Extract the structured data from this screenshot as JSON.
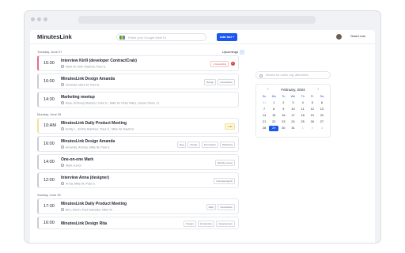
{
  "app": {
    "logo": "MinutesLink",
    "search_placeholder": "Paste your Google Meet ID",
    "add_button": "Add bot +",
    "user_name": "David Luis"
  },
  "header": {
    "upcoming_label": "Upcomings"
  },
  "sections": [
    {
      "date": "Tuesday, June 27",
      "events": [
        {
          "time": "16:30",
          "title": "Interview Kirill (developer ContractCrab)",
          "people": "Mark M, Kirill Vlashna, Paul S.",
          "tags": [
            {
              "label": "• Connecting",
              "style": "red"
            }
          ],
          "badge": "1",
          "accent": "#e86b8a"
        },
        {
          "time": "16:00",
          "title": "MinutesLink Design Amanda",
          "people": "Amanda, Mark M, Paul S.",
          "tags": [
            {
              "label": "Design",
              "style": ""
            },
            {
              "label": "Introduction",
              "style": ""
            }
          ],
          "accent": "#c9ccd3"
        },
        {
          "time": "14:30",
          "title": "Marketing meetup",
          "people": "Baru, Anthony Maninez, Paul S., Mike W, Peter Miles, Susan Owns +1",
          "tags": [],
          "accent": "#c9ccd3"
        }
      ]
    },
    {
      "date": "Monday, June 26",
      "events": [
        {
          "time": "10:AM",
          "title": "MinutesLink Daily Product Meeting",
          "people": "Emily L., Emilio Martinez, Paul S., Mike W, David B.",
          "tags": [
            {
              "label": "• Idle",
              "style": "yellow"
            }
          ],
          "accent": "#f0e29a"
        },
        {
          "time": "16:00",
          "title": "MinutesLink Design Amanda",
          "people": "Amanda, Antony, Mike W, Paul S.",
          "tags": [
            {
              "label": "Idea",
              "style": ""
            },
            {
              "label": "Design",
              "style": ""
            },
            {
              "label": "Information",
              "style": ""
            },
            {
              "label": "Marketing",
              "style": ""
            }
          ],
          "accent": "#c9ccd3"
        },
        {
          "time": "14:00",
          "title": "One-on-one Mark",
          "people": "Mark Junior",
          "tags": [
            {
              "label": "Weekly review",
              "style": ""
            }
          ],
          "accent": "#c9ccd3"
        },
        {
          "time": "12:00",
          "title": "Interview Anna (designer)",
          "people": "Anna, Mike W, Paul S.",
          "tags": [
            {
              "label": "Interviewing(rd)",
              "style": ""
            }
          ],
          "accent": "#c9ccd3"
        }
      ]
    },
    {
      "date": "Sunday, June 25",
      "events": [
        {
          "time": "17:30",
          "title": "MinutesLink Daily Product Meeting",
          "people": "Biru, Anton, Paul Salvador, Mike W",
          "tags": [
            {
              "label": "Daily",
              "style": ""
            },
            {
              "label": "Introduction",
              "style": ""
            }
          ],
          "accent": "#c9ccd3"
        },
        {
          "time": "16:00",
          "title": "MinutesLink Design Rita",
          "people": "",
          "tags": [
            {
              "label": "Design",
              "style": ""
            },
            {
              "label": "Introduction",
              "style": ""
            },
            {
              "label": "Development",
              "style": ""
            }
          ],
          "accent": "#c9ccd3"
        }
      ]
    }
  ],
  "sidebar": {
    "search_placeholder": "Search for notes, log, attendees",
    "calendar": {
      "month": "February, 2024",
      "weekdays": [
        "Su",
        "Mo",
        "Tu",
        "We",
        "Th",
        "Fr",
        "Sa"
      ],
      "days": [
        {
          "d": "31",
          "m": true
        },
        {
          "d": "1"
        },
        {
          "d": "2"
        },
        {
          "d": "3"
        },
        {
          "d": "4"
        },
        {
          "d": "5"
        },
        {
          "d": "6"
        },
        {
          "d": "7"
        },
        {
          "d": "8"
        },
        {
          "d": "9"
        },
        {
          "d": "10"
        },
        {
          "d": "11"
        },
        {
          "d": "12"
        },
        {
          "d": "13"
        },
        {
          "d": "14"
        },
        {
          "d": "15"
        },
        {
          "d": "16"
        },
        {
          "d": "17"
        },
        {
          "d": "18"
        },
        {
          "d": "19"
        },
        {
          "d": "20"
        },
        {
          "d": "21"
        },
        {
          "d": "22"
        },
        {
          "d": "23"
        },
        {
          "d": "24"
        },
        {
          "d": "25"
        },
        {
          "d": "26"
        },
        {
          "d": "27"
        },
        {
          "d": "28"
        },
        {
          "d": "29",
          "t": true
        },
        {
          "d": "30"
        },
        {
          "d": "31"
        },
        {
          "d": "1",
          "m": true
        },
        {
          "d": "2",
          "m": true
        },
        {
          "d": "3",
          "m": true
        }
      ]
    }
  }
}
